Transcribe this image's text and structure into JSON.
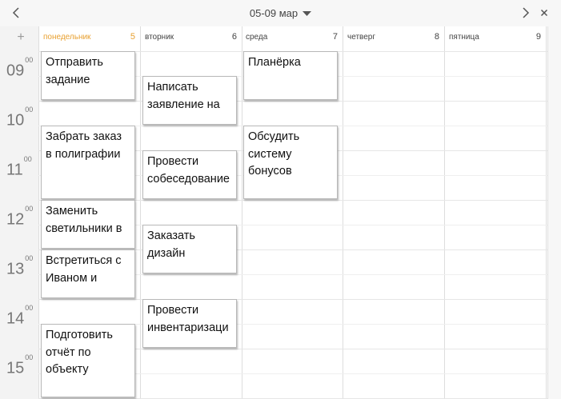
{
  "header": {
    "title": "05-09 мар"
  },
  "icons": {
    "prev": "chevron-left-icon",
    "next": "chevron-right-icon",
    "dropdown": "caret-down-icon",
    "close": "close-icon",
    "add": "plus-icon"
  },
  "colors": {
    "today": "#e8a030"
  },
  "add_label": "+",
  "hours": [
    "09",
    "10",
    "11",
    "12",
    "13",
    "14",
    "15"
  ],
  "minutes_label": "00",
  "days": [
    {
      "name": "понедельник",
      "num": "5",
      "today": true
    },
    {
      "name": "вторник",
      "num": "6",
      "today": false
    },
    {
      "name": "среда",
      "num": "7",
      "today": false
    },
    {
      "name": "четверг",
      "num": "8",
      "today": false
    },
    {
      "name": "пятница",
      "num": "9",
      "today": false
    }
  ],
  "events": [
    {
      "day": 0,
      "text": "Отправить задание"
    },
    {
      "day": 0,
      "text": "Забрать заказ в полиграфии"
    },
    {
      "day": 0,
      "text": "Заменить светильники в"
    },
    {
      "day": 0,
      "text": "Встретиться с Иваном и"
    },
    {
      "day": 0,
      "text": "Подготовить отчёт по объекту"
    },
    {
      "day": 1,
      "text": "Написать заявление на"
    },
    {
      "day": 1,
      "text": "Провести собеседование"
    },
    {
      "day": 1,
      "text": "Заказать дизайн"
    },
    {
      "day": 1,
      "text": "Провести инвентаризаци"
    },
    {
      "day": 2,
      "text": "Планёрка"
    },
    {
      "day": 2,
      "text": "Обсудить систему бонусов"
    }
  ]
}
